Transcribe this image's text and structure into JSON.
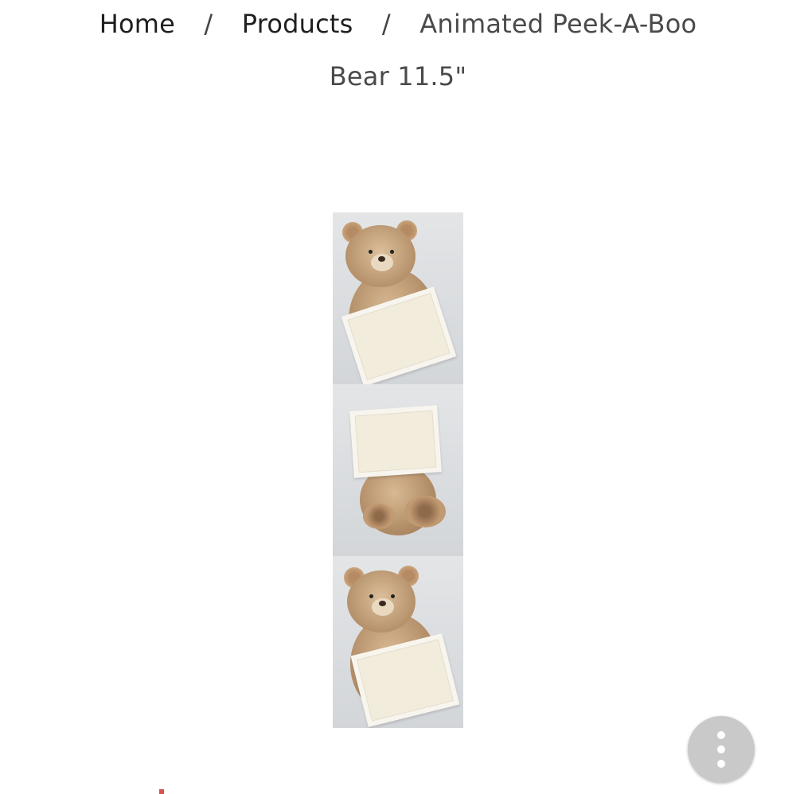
{
  "breadcrumb": {
    "home_label": "Home",
    "products_label": "Products",
    "separator": "/",
    "current_line1": "Animated Peek-A-Boo",
    "current_line2": "Bear 11.5\""
  },
  "product_image": {
    "alt": "Animated Peek-A-Boo Bear 11.5\" product photo strip",
    "panels": [
      "bear-holding-blanket",
      "bear-hiding-behind-blanket",
      "bear-peeking-with-blanket"
    ]
  },
  "fab": {
    "icon": "more-vertical-icon"
  },
  "colors": {
    "fab_background": "#c9c9c9",
    "text": "#2b2b2b",
    "background": "#ffffff"
  }
}
